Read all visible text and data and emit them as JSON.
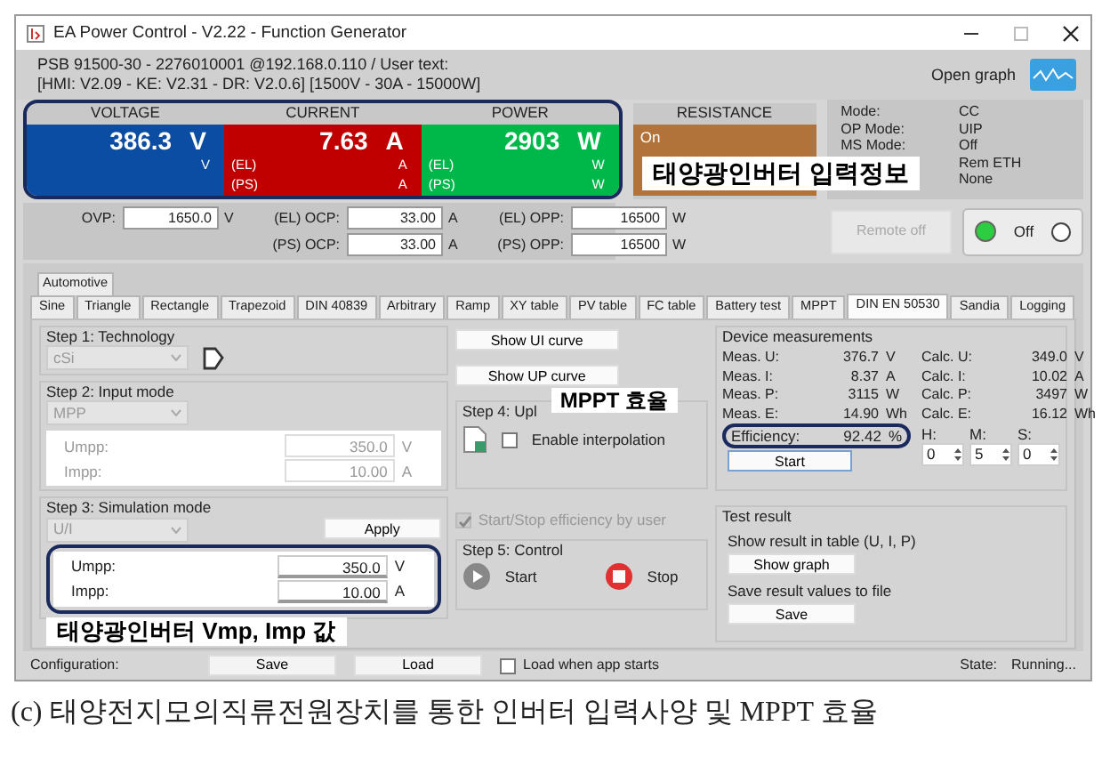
{
  "window": {
    "title": "EA Power Control - V2.22 - Function Generator"
  },
  "device": {
    "line1": "PSB 91500-30 - 2276010001 @192.168.0.110 / User text:",
    "line2": "[HMI: V2.09 - KE: V2.31 - DR: V2.0.6] [1500V - 30A - 15000W]",
    "open_graph": "Open graph"
  },
  "readouts": [
    {
      "heading": "VOLTAGE",
      "value": "386.3",
      "unit": "V",
      "color": "#0b4da2",
      "rows": [
        {
          "unit": "V"
        }
      ]
    },
    {
      "heading": "CURRENT",
      "value": "7.63",
      "unit": "A",
      "color": "#c00000",
      "rows": [
        {
          "label": "(EL)",
          "unit": "A"
        },
        {
          "label": "(PS)",
          "unit": "A"
        }
      ]
    },
    {
      "heading": "POWER",
      "value": "2903",
      "unit": "W",
      "color": "#00b84a",
      "rows": [
        {
          "label": "(EL)",
          "unit": "W"
        },
        {
          "label": "(PS)",
          "unit": "W"
        }
      ]
    }
  ],
  "resistance": {
    "heading": "RESISTANCE",
    "state": "On"
  },
  "status": [
    {
      "label": "Mode:",
      "value": "CC"
    },
    {
      "label": "OP Mode:",
      "value": "UIP"
    },
    {
      "label": "MS Mode:",
      "value": "Off"
    },
    {
      "value": "Rem ETH"
    },
    {
      "value": "None"
    }
  ],
  "limits": [
    {
      "label": "OVP:",
      "value": "1650.0",
      "unit": "V"
    },
    {
      "label": "(EL) OCP:",
      "value": "33.00",
      "unit": "A"
    },
    {
      "label": "(PS) OCP:",
      "value": "33.00",
      "unit": "A"
    },
    {
      "label": "(EL) OPP:",
      "value": "16500",
      "unit": "W"
    },
    {
      "label": "(PS) OPP:",
      "value": "16500",
      "unit": "W"
    }
  ],
  "remote_button": {
    "label": "Remote off",
    "disabled": true
  },
  "output": {
    "label": "Off",
    "on": true,
    "radio_checked": false
  },
  "tabs_top": [
    {
      "label": "Automotive",
      "selected": false
    }
  ],
  "tabs": [
    {
      "label": "Sine",
      "selected": false
    },
    {
      "label": "Triangle",
      "selected": false
    },
    {
      "label": "Rectangle",
      "selected": false
    },
    {
      "label": "Trapezoid",
      "selected": false
    },
    {
      "label": "DIN 40839",
      "selected": false
    },
    {
      "label": "Arbitrary",
      "selected": false
    },
    {
      "label": "Ramp",
      "selected": false
    },
    {
      "label": "XY table",
      "selected": false
    },
    {
      "label": "PV table",
      "selected": false
    },
    {
      "label": "FC table",
      "selected": false
    },
    {
      "label": "Battery test",
      "selected": false
    },
    {
      "label": "MPPT",
      "selected": false
    },
    {
      "label": "DIN EN 50530",
      "selected": true
    },
    {
      "label": "Sandia",
      "selected": false
    },
    {
      "label": "Logging",
      "selected": false
    }
  ],
  "step1": {
    "title": "Step 1: Technology",
    "combo": "cSi"
  },
  "step2": {
    "title": "Step 2: Input mode",
    "combo": "MPP",
    "disabled": true,
    "fields": [
      {
        "label": "Umpp:",
        "value": "350.0",
        "unit": "V"
      },
      {
        "label": "Impp:",
        "value": "10.00",
        "unit": "A"
      }
    ]
  },
  "step3": {
    "title": "Step 3: Simulation mode",
    "combo": "U/I",
    "apply": "Apply",
    "disabled": false,
    "fields": [
      {
        "label": "Umpp:",
        "value": "350.0",
        "unit": "V"
      },
      {
        "label": "Impp:",
        "value": "10.00",
        "unit": "A"
      }
    ]
  },
  "curve_buttons": [
    "Show UI curve",
    "Show UP curve"
  ],
  "step4": {
    "title": "Step 4: Upl",
    "interpolation": {
      "label": "Enable interpolation",
      "checked": false
    }
  },
  "by_user": {
    "label": "Start/Stop efficiency by user",
    "checked": true,
    "disabled": true
  },
  "step5": {
    "title": "Step 5: Control",
    "start": "Start",
    "stop": "Stop"
  },
  "measurements": {
    "title": "Device measurements",
    "rows": [
      {
        "label": "Meas. U:",
        "value": "376.7",
        "unit": "V",
        "calc_label": "Calc. U:",
        "calc_value": "349.0",
        "calc_unit": "V"
      },
      {
        "label": "Meas. I:",
        "value": "8.37",
        "unit": "A",
        "calc_label": "Calc. I:",
        "calc_value": "10.02",
        "calc_unit": "A"
      },
      {
        "label": "Meas. P:",
        "value": "3115",
        "unit": "W",
        "calc_label": "Calc. P:",
        "calc_value": "3497",
        "calc_unit": "W"
      },
      {
        "label": "Meas. E:",
        "value": "14.90",
        "unit": "Wh",
        "calc_label": "Calc. E:",
        "calc_value": "16.12",
        "calc_unit": "Wh"
      }
    ],
    "efficiency": {
      "label": "Efficiency:",
      "value": "92.42",
      "unit": "%"
    },
    "start": "Start",
    "timer": [
      {
        "label": "H:",
        "value": "0"
      },
      {
        "label": "M:",
        "value": "5"
      },
      {
        "label": "S:",
        "value": "0"
      }
    ]
  },
  "test_result": {
    "title": "Test result",
    "table_text": "Show result in table (U, I, P)",
    "graph_button": "Show graph",
    "file_text": "Save result values to file",
    "save_button": "Save"
  },
  "bottom": {
    "label": "Configuration:",
    "save": "Save",
    "load": "Load",
    "load_on_start": {
      "label": "Load when app starts",
      "checked": false
    },
    "state_label": "State:",
    "state": "Running..."
  },
  "annotations": [
    "태양광인버터 입력정보",
    "MPPT 효율",
    "태양광인버터 Vmp, Imp 값"
  ],
  "caption": "(c) 태양전지모의직류전원장치를 통한 인버터 입력사양 및 MPPT 효율"
}
